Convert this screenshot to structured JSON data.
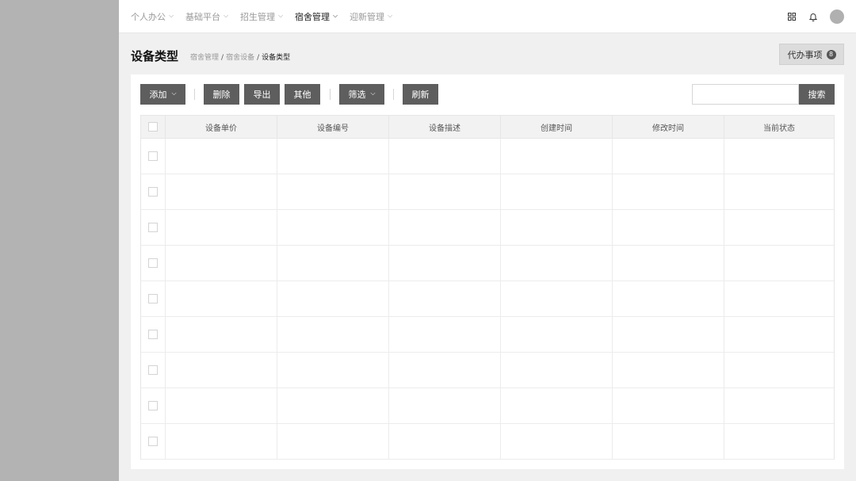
{
  "nav": {
    "items": [
      {
        "label": "个人办公",
        "active": false
      },
      {
        "label": "基础平台",
        "active": false
      },
      {
        "label": "招生管理",
        "active": false
      },
      {
        "label": "宿舍管理",
        "active": true
      },
      {
        "label": "迎新管理",
        "active": false
      }
    ],
    "icons": [
      "grid-icon",
      "bell-icon",
      "avatar"
    ]
  },
  "header": {
    "title": "设备类型",
    "breadcrumb": [
      "宿舍管理",
      "宿舍设备",
      "设备类型"
    ],
    "todo_label": "代办事项",
    "todo_count": "8"
  },
  "toolbar": {
    "add": "添加",
    "delete": "删除",
    "export": "导出",
    "other": "其他",
    "filter": "筛选",
    "refresh": "刷新",
    "search_button": "搜索",
    "search_value": ""
  },
  "table": {
    "columns": [
      "设备单价",
      "设备编号",
      "设备描述",
      "创建时间",
      "修改时间",
      "当前状态"
    ],
    "rows": [
      [
        "",
        "",
        "",
        "",
        "",
        ""
      ],
      [
        "",
        "",
        "",
        "",
        "",
        ""
      ],
      [
        "",
        "",
        "",
        "",
        "",
        ""
      ],
      [
        "",
        "",
        "",
        "",
        "",
        ""
      ],
      [
        "",
        "",
        "",
        "",
        "",
        ""
      ],
      [
        "",
        "",
        "",
        "",
        "",
        ""
      ],
      [
        "",
        "",
        "",
        "",
        "",
        ""
      ],
      [
        "",
        "",
        "",
        "",
        "",
        ""
      ],
      [
        "",
        "",
        "",
        "",
        "",
        ""
      ]
    ]
  },
  "colors": {
    "sidebar": "#b3b3b3",
    "button": "#5e5e5e",
    "background": "#f0f0f0"
  }
}
